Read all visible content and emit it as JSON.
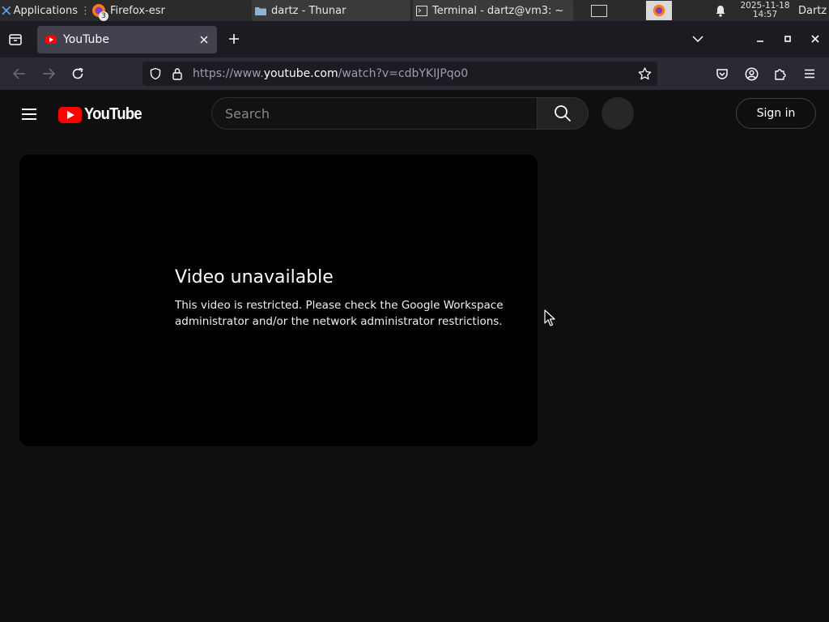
{
  "taskbar": {
    "apps_label": "Applications",
    "firefox_badge": "3",
    "tasks": [
      {
        "label": "Firefox-esr"
      },
      {
        "label": "dartz - Thunar"
      },
      {
        "label": "Terminal - dartz@vm3: ~"
      }
    ],
    "clock_date": "2025-11-18",
    "clock_time": "14:57",
    "user": "Dartz"
  },
  "browser": {
    "tab_title": "YouTube",
    "url_prefix": "https://www.",
    "url_host": "youtube.com",
    "url_path": "/watch?v=cdbYKIJPqo0"
  },
  "youtube": {
    "logo_text": "YouTube",
    "search_placeholder": "Search",
    "sign_in_label": "Sign in",
    "error_title": "Video unavailable",
    "error_message": "This video is restricted. Please check the Google Workspace administrator and/or the network administrator restrictions."
  },
  "colors": {
    "youtube_red": "#ff0000",
    "page_bg": "#0f0f0f",
    "toolbar_bg": "#2b2a33"
  }
}
